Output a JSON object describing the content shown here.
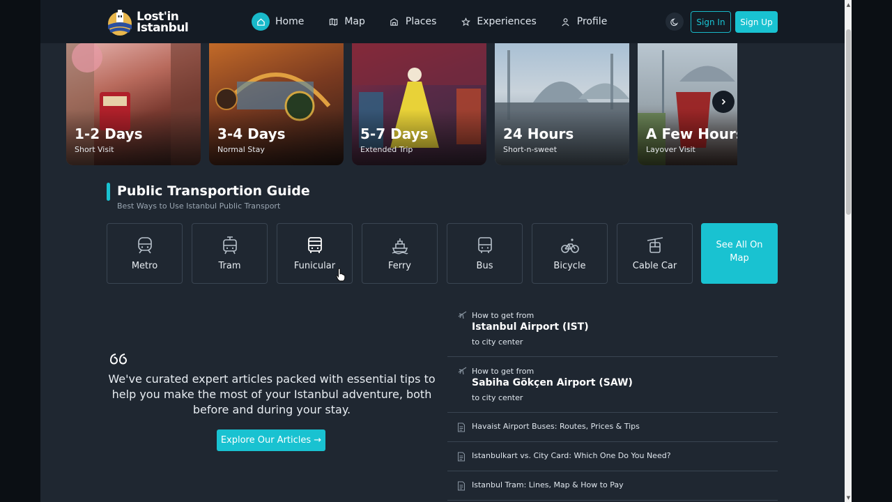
{
  "logo": {
    "line1": "Lost'in",
    "line2": "Istanbul"
  },
  "nav": [
    {
      "label": "Home",
      "icon": "home-icon",
      "active": true
    },
    {
      "label": "Map",
      "icon": "map-icon"
    },
    {
      "label": "Places",
      "icon": "places-icon"
    },
    {
      "label": "Experiences",
      "icon": "star-icon"
    },
    {
      "label": "Profile",
      "icon": "user-icon"
    }
  ],
  "auth": {
    "signin": "Sign In",
    "signup": "Sign Up"
  },
  "accent": "#19c2d1",
  "trips": [
    {
      "title": "1-2 Days",
      "sub": "Short Visit"
    },
    {
      "title": "3-4 Days",
      "sub": "Normal Stay"
    },
    {
      "title": "5-7 Days",
      "sub": "Extended Trip"
    },
    {
      "title": "24 Hours",
      "sub": "Short-n-sweet"
    },
    {
      "title": "A Few Hours",
      "sub": "Layover Visit"
    }
  ],
  "transport": {
    "title": "Public Transportion Guide",
    "subtitle": "Best Ways to Use Istanbul Public Transport",
    "items": [
      "Metro",
      "Tram",
      "Funicular",
      "Ferry",
      "Bus",
      "Bicycle",
      "Cable Car"
    ],
    "cta": "See All On Map"
  },
  "quote": {
    "text": "We've curated expert articles packed with essential tips to help you make the most of your Istanbul adventure, both before and during your stay.",
    "button": "Explore Our Articles →"
  },
  "articles": {
    "featured": [
      {
        "pre": "How to get from",
        "main": "Istanbul Airport (IST)",
        "post": "to city center"
      },
      {
        "pre": "How to get from",
        "main": "Sabiha Gökçen Airport (SAW)",
        "post": "to city center"
      }
    ],
    "list": [
      "Havaist Airport Buses: Routes, Prices & Tips",
      "Istanbulkart vs. City Card: Which One Do You Need?",
      "Istanbul Tram: Lines, Map & How to Pay"
    ]
  }
}
